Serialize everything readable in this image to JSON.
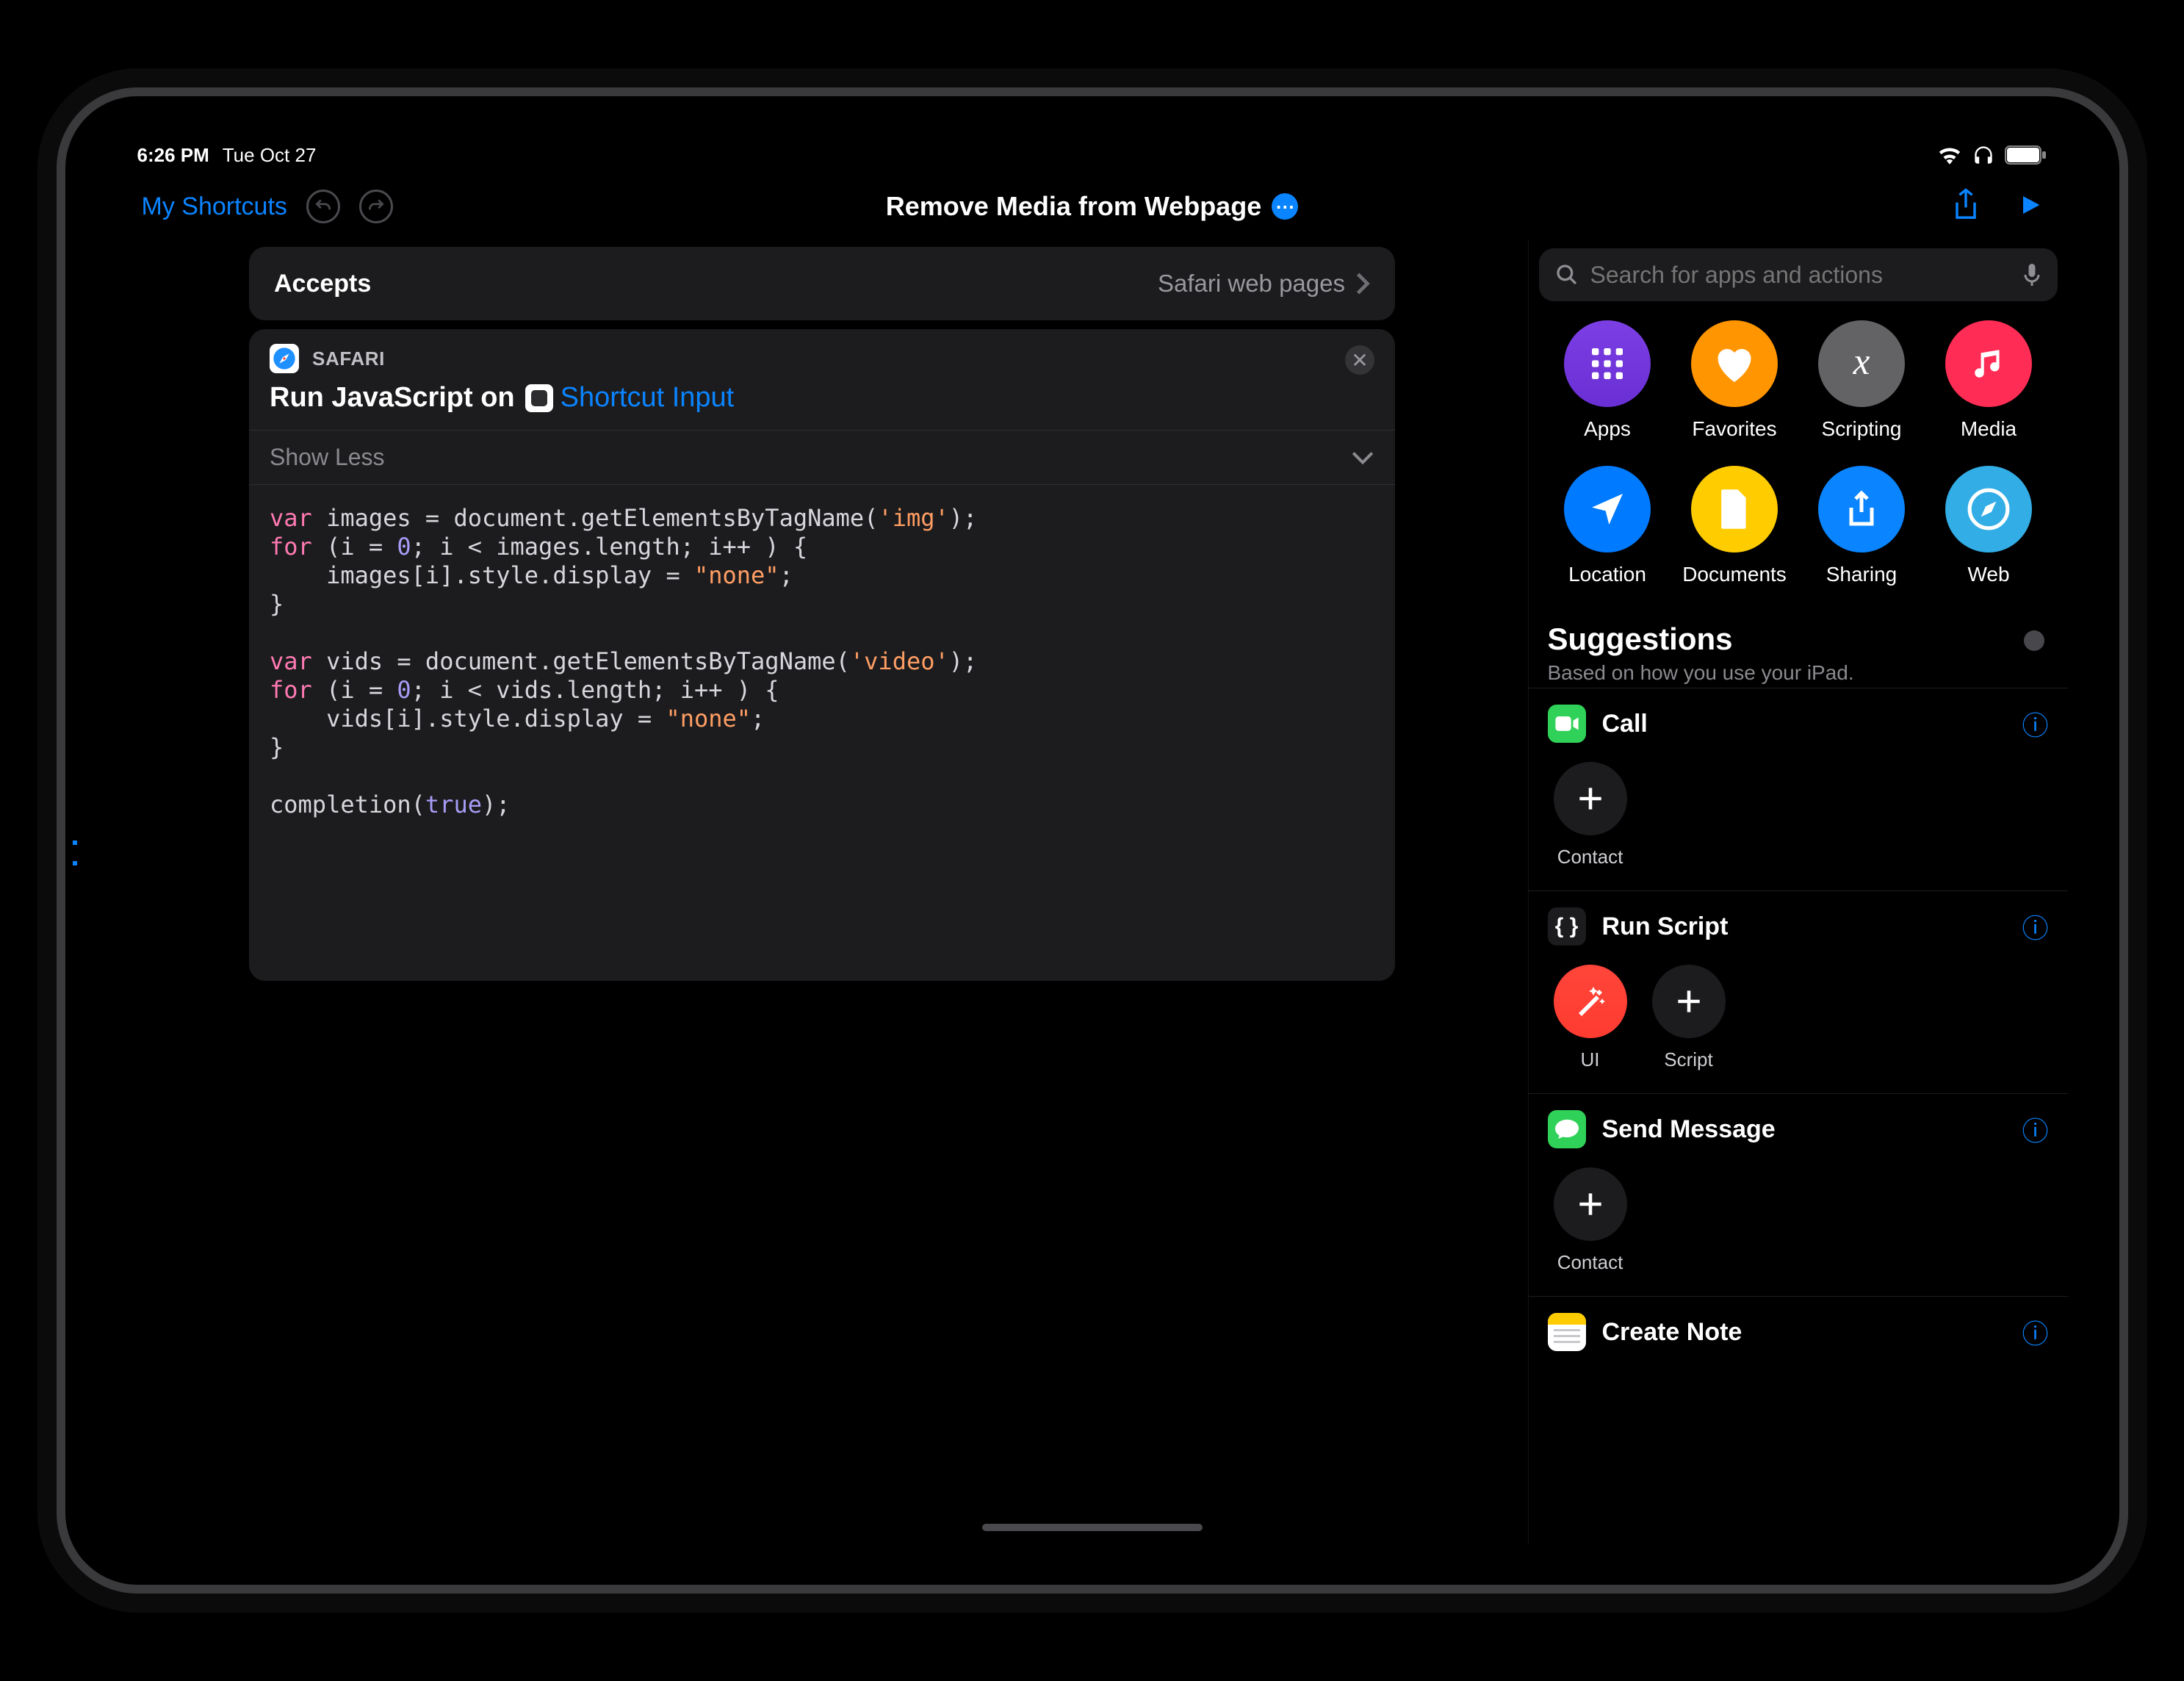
{
  "status": {
    "time": "6:26 PM",
    "date": "Tue Oct 27"
  },
  "toolbar": {
    "back_label": "My Shortcuts",
    "title": "Remove Media from Webpage"
  },
  "accepts": {
    "label": "Accepts",
    "value": "Safari web pages"
  },
  "action": {
    "app": "SAFARI",
    "prefix": "Run JavaScript on",
    "token": "Shortcut Input",
    "show_less": "Show Less",
    "code_lines": [
      {
        "t": "kw",
        "s": "var"
      },
      {
        "t": "p",
        "s": " images = document.getElementsByTagName("
      },
      {
        "t": "str",
        "s": "'img'"
      },
      {
        "t": "p",
        "s": ");\n"
      },
      {
        "t": "kw",
        "s": "for"
      },
      {
        "t": "p",
        "s": " (i = "
      },
      {
        "t": "num",
        "s": "0"
      },
      {
        "t": "p",
        "s": "; i < images.length; i++ ) {\n    images[i].style.display = "
      },
      {
        "t": "str",
        "s": "\"none\""
      },
      {
        "t": "p",
        "s": ";\n}\n\n"
      },
      {
        "t": "kw",
        "s": "var"
      },
      {
        "t": "p",
        "s": " vids = document.getElementsByTagName("
      },
      {
        "t": "str",
        "s": "'video'"
      },
      {
        "t": "p",
        "s": ");\n"
      },
      {
        "t": "kw",
        "s": "for"
      },
      {
        "t": "p",
        "s": " (i = "
      },
      {
        "t": "num",
        "s": "0"
      },
      {
        "t": "p",
        "s": "; i < vids.length; i++ ) {\n    vids[i].style.display = "
      },
      {
        "t": "str",
        "s": "\"none\""
      },
      {
        "t": "p",
        "s": ";\n}\n\ncompletion("
      },
      {
        "t": "bool",
        "s": "true"
      },
      {
        "t": "p",
        "s": ");"
      }
    ]
  },
  "search": {
    "placeholder": "Search for apps and actions"
  },
  "categories": [
    {
      "label": "Apps",
      "bg": "bg-purple",
      "icon": "grid"
    },
    {
      "label": "Favorites",
      "bg": "bg-orange",
      "icon": "heart"
    },
    {
      "label": "Scripting",
      "bg": "bg-gray",
      "icon": "fx"
    },
    {
      "label": "Media",
      "bg": "bg-pink",
      "icon": "music"
    },
    {
      "label": "Location",
      "bg": "bg-blue",
      "icon": "nav"
    },
    {
      "label": "Documents",
      "bg": "bg-yellow",
      "icon": "doc"
    },
    {
      "label": "Sharing",
      "bg": "bg-blue2",
      "icon": "share"
    },
    {
      "label": "Web",
      "bg": "bg-cyan",
      "icon": "compass"
    }
  ],
  "suggestions": {
    "title": "Suggestions",
    "subtitle": "Based on how you use your iPad.",
    "items": [
      {
        "title": "Call",
        "icon": "facetime",
        "icon_bg": "#30d158",
        "minis": [
          {
            "label": "Contact",
            "type": "plus"
          }
        ]
      },
      {
        "title": "Run Script",
        "icon": "braces",
        "icon_bg": "#1c1c1e",
        "minis": [
          {
            "label": "UI",
            "type": "ui"
          },
          {
            "label": "Script",
            "type": "plus"
          }
        ]
      },
      {
        "title": "Send Message",
        "icon": "messages",
        "icon_bg": "#30d158",
        "minis": [
          {
            "label": "Contact",
            "type": "plus"
          }
        ]
      },
      {
        "title": "Create Note",
        "icon": "notes",
        "icon_bg": "#ffcc00",
        "minis": []
      }
    ]
  }
}
